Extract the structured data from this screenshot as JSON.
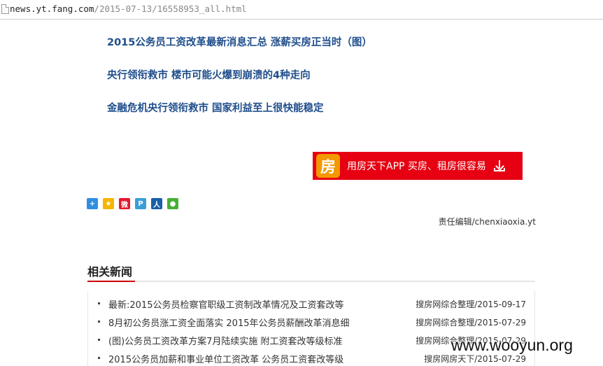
{
  "browser": {
    "url_host": "news.yt.fang.com",
    "url_path": "/2015-07-13/16558953_all.html"
  },
  "headlines": [
    "2015公务员工资改革最新消息汇总 涨薪买房正当时（图）",
    "央行领衔救市 楼市可能火爆到崩溃的4种走向",
    "金融危机央行领衔救市 国家利益至上很快能稳定"
  ],
  "app_banner": {
    "logo_char": "房",
    "text": "用房天下APP  买房、租房很容易"
  },
  "share_icons": [
    {
      "name": "share-more-icon",
      "glyph": "+",
      "color": "#2f8ee0"
    },
    {
      "name": "qzone-icon",
      "glyph": "★",
      "color": "#f5b500"
    },
    {
      "name": "weibo-icon",
      "glyph": "微",
      "color": "#e6162d"
    },
    {
      "name": "tencent-weibo-icon",
      "glyph": "P",
      "color": "#3a9fd6"
    },
    {
      "name": "renren-icon",
      "glyph": "人",
      "color": "#1a5fa8"
    },
    {
      "name": "wechat-icon",
      "glyph": "●",
      "color": "#46b035"
    }
  ],
  "editor": "责任编辑/chenxiaoxia.yt",
  "related": {
    "title": "相关新闻",
    "items": [
      {
        "title": "最新:2015公务员检察官职级工资制改革情况及工资套改等",
        "source": "搜房网综合整理/2015-09-17"
      },
      {
        "title": "8月初公务员涨工资全面落实 2015年公务员薪酬改革消息细",
        "source": "搜房网综合整理/2015-07-29"
      },
      {
        "title": "(图)公务员工资改革方案7月陆续实施 附工资套改等级标准",
        "source": "搜房网综合整理/2015-07-29"
      },
      {
        "title": "2015公务员加薪和事业单位工资改革 公务员工资套改等级",
        "source": "搜房网房天下/2015-07-29"
      }
    ]
  },
  "watermark": "www.wooyun.org"
}
